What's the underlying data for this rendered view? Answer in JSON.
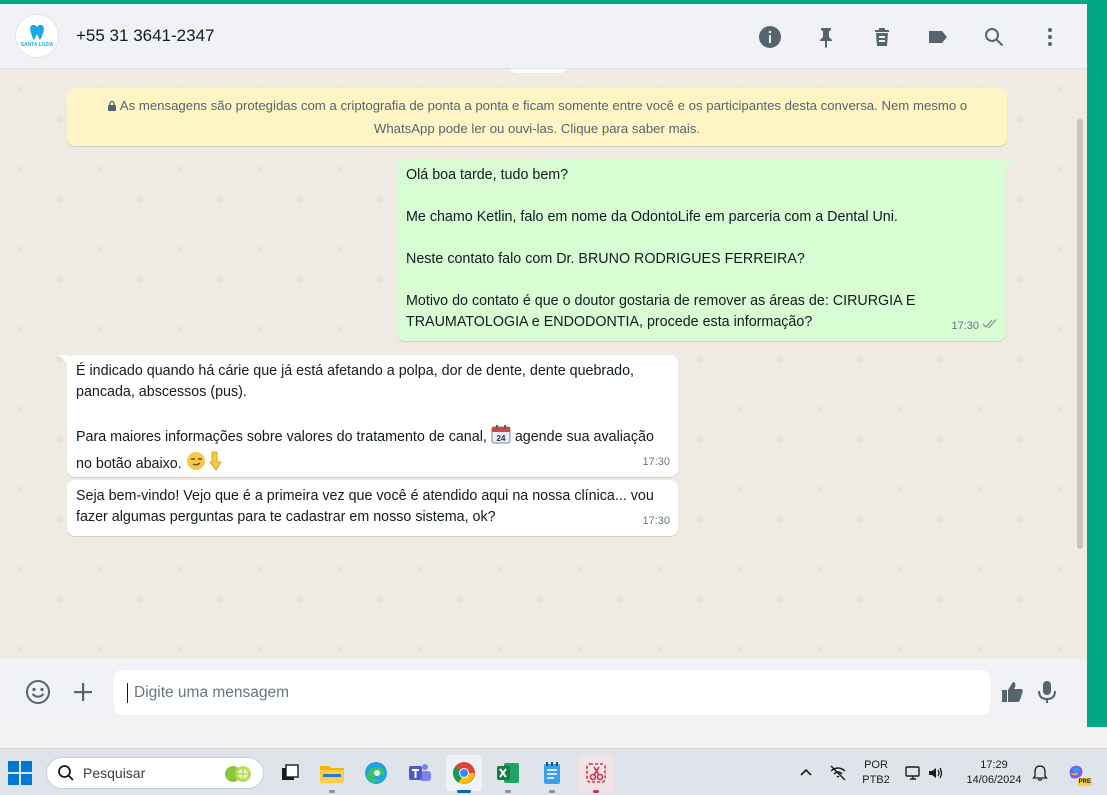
{
  "header": {
    "contact_name": "+55 31 3641-2347",
    "avatar_brand": "SANTA LUZIA",
    "icons": [
      "info-icon",
      "pin-icon",
      "delete-icon",
      "label-icon",
      "search-icon",
      "menu-icon"
    ]
  },
  "chat": {
    "encryption_notice": "As mensagens são protegidas com a criptografia de ponta a ponta e ficam somente entre você e os participantes desta conversa. Nem mesmo o WhatsApp pode ler ou ouvi-las. Clique para saber mais.",
    "messages": [
      {
        "direction": "out",
        "paragraphs": [
          "Olá boa tarde, tudo bem?",
          "Me chamo Ketlin, falo em nome da OdontoLife em parceria com a Dental Uni.",
          "Neste contato falo com Dr. BRUNO RODRIGUES FERREIRA?",
          "Motivo do contato é que o doutor gostaria de remover as áreas de: CIRURGIA E TRAUMATOLOGIA e ENDODONTIA, procede esta informação?"
        ],
        "time": "17:30",
        "status": "read"
      },
      {
        "direction": "in",
        "p1": "É indicado quando há cárie que já está afetando a polpa, dor de dente, dente quebrado, pancada, abscessos (pus).",
        "p2_a": "Para maiores informações sobre valores do tratamento de canal,",
        "p2_emoji": "📆",
        "p2_b": "agende sua avaliação no botão abaixo.",
        "p2_end_emoji": "😏👇",
        "time": "17:30"
      },
      {
        "direction": "in",
        "text": "Seja bem-vindo! Vejo que é a primeira vez que você é atendido aqui na nossa clínica... vou fazer algumas perguntas para te cadastrar em nosso sistema, ok?",
        "time": "17:30"
      }
    ]
  },
  "composer": {
    "placeholder": "Digite uma mensagem",
    "value": ""
  },
  "taskbar": {
    "search_label": "Pesquisar",
    "language_top": "POR",
    "language_bottom": "PTB2",
    "clock_time": "17:29",
    "clock_date": "14/06/2024",
    "copilot_badge": "PRE",
    "accent": "#0078d4"
  },
  "colors": {
    "accent": "#00a884",
    "outgoing_bubble": "#d9fdd3",
    "incoming_bubble": "#ffffff",
    "notice_bg": "#fff5c4"
  }
}
